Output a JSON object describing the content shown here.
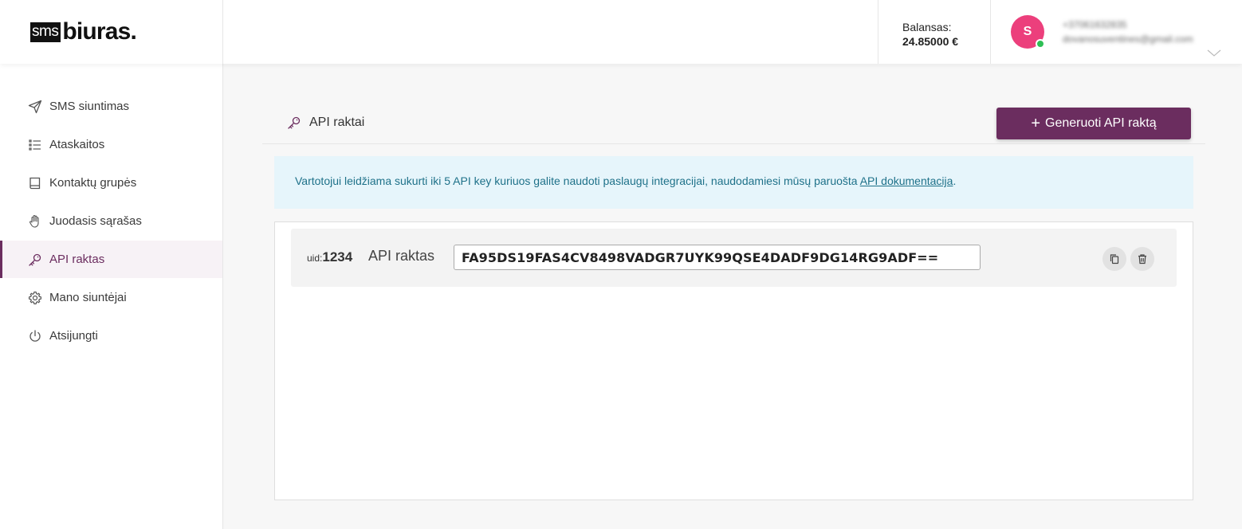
{
  "brand": {
    "sms": "sms",
    "biuras": "biuras."
  },
  "header": {
    "balance_label": "Balansas:",
    "balance_value": "24.85000 €",
    "user": {
      "avatar_letter": "S",
      "phone": "+37061632835",
      "email": "dovanosuventines@gmail.com"
    }
  },
  "sidebar": {
    "items": [
      {
        "label": "SMS siuntimas",
        "icon": "send-icon"
      },
      {
        "label": "Ataskaitos",
        "icon": "list-icon"
      },
      {
        "label": "Kontaktų grupės",
        "icon": "book-icon"
      },
      {
        "label": "Juodasis sąrašas",
        "icon": "hand-icon"
      },
      {
        "label": "API raktas",
        "icon": "key-icon",
        "active": true
      },
      {
        "label": "Mano siuntėjai",
        "icon": "gear-icon"
      },
      {
        "label": "Atsijungti",
        "icon": "power-icon"
      }
    ]
  },
  "main": {
    "title": "API raktai",
    "generate_button": "Generuoti API raktą",
    "info": {
      "text": "Vartotojui leidžiama sukurti iki 5 API key kuriuos galite naudoti paslaugų integracijai, naudodamiesi mūsų paruošta ",
      "link": "API dokumentacija",
      "suffix": "."
    },
    "keys": [
      {
        "uid_label": "uid:",
        "uid": "1234",
        "label": "API raktas",
        "value": "FA95DS19FAS4CV8498VADGR7UYK99QSE4DADF9DG14RG9ADF=="
      }
    ]
  },
  "colors": {
    "brand": "#6b2d5f",
    "avatar": "#ec3f7c",
    "online": "#2fbf55",
    "info_bg": "#e6f5fb",
    "info_text": "#1e7189"
  }
}
